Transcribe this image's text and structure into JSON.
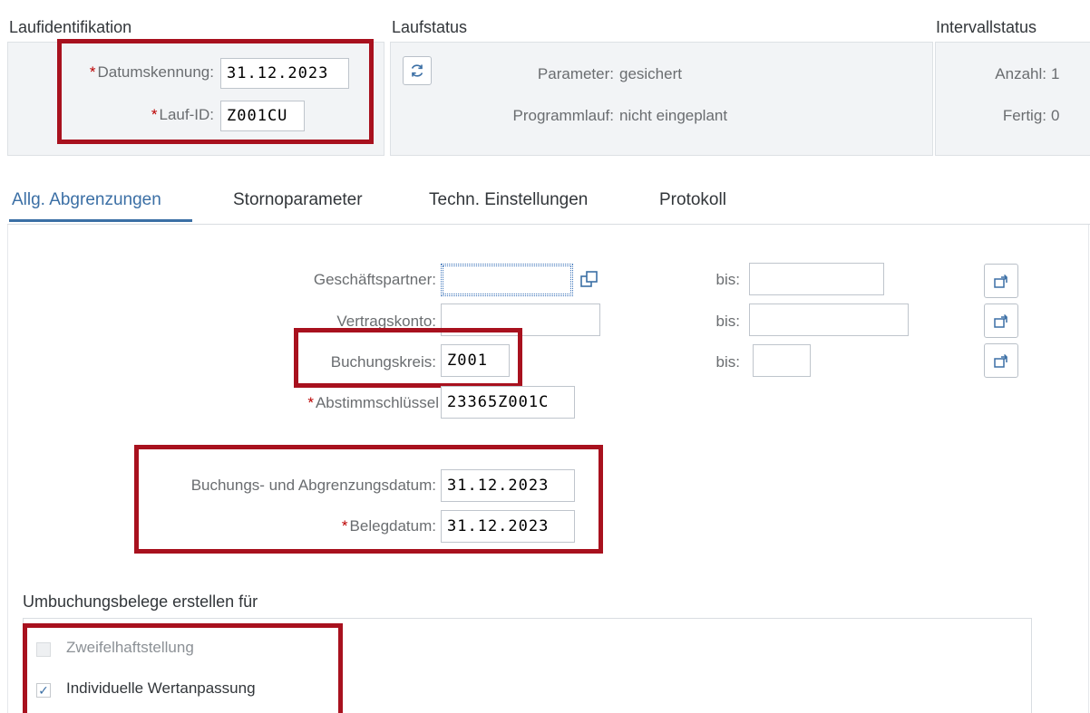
{
  "header": {
    "run_identification": "Laufidentifikation",
    "run_status": "Laufstatus",
    "interval_status": "Intervallstatus"
  },
  "run_id": {
    "date_label": "Datumskennung:",
    "date_value": "31.12.2023",
    "run_label": "Lauf-ID:",
    "run_value": "Z001CU",
    "required_marker": "*"
  },
  "status": {
    "parameter_label": "Parameter:",
    "parameter_value": "gesichert",
    "program_label": "Programmlauf:",
    "program_value": "nicht eingeplant"
  },
  "interval": {
    "count_label": "Anzahl:",
    "count_value": "1",
    "done_label": "Fertig:",
    "done_value": "0"
  },
  "tabs": [
    {
      "label": "Allg. Abgrenzungen",
      "active": true
    },
    {
      "label": "Stornoparameter"
    },
    {
      "label": "Techn. Einstellungen"
    },
    {
      "label": "Protokoll"
    }
  ],
  "form": {
    "business_partner_label": "Geschäftspartner:",
    "business_partner_value": "",
    "contract_account_label": "Vertragskonto:",
    "contract_account_value": "",
    "company_code_label": "Buchungskreis:",
    "company_code_value": "Z001",
    "reconciliation_key_label": "Abstimmschlüssel",
    "reconciliation_key_value": "23365Z001C",
    "to_label": "bis:",
    "posting_date_label": "Buchungs- und Abgrenzungsdatum:",
    "posting_date_value": "31.12.2023",
    "document_date_label": "Belegdatum:",
    "document_date_value": "31.12.2023"
  },
  "section": {
    "title": "Umbuchungsbelege erstellen für",
    "items": [
      {
        "label": "Zweifelhaftstellung",
        "checked": false,
        "disabled": true
      },
      {
        "label": "Individuelle Wertanpassung",
        "checked": true,
        "disabled": false
      }
    ]
  },
  "colors": {
    "accent": "#3b6fa5",
    "highlight": "#a8111e",
    "required": "#bb0000"
  }
}
